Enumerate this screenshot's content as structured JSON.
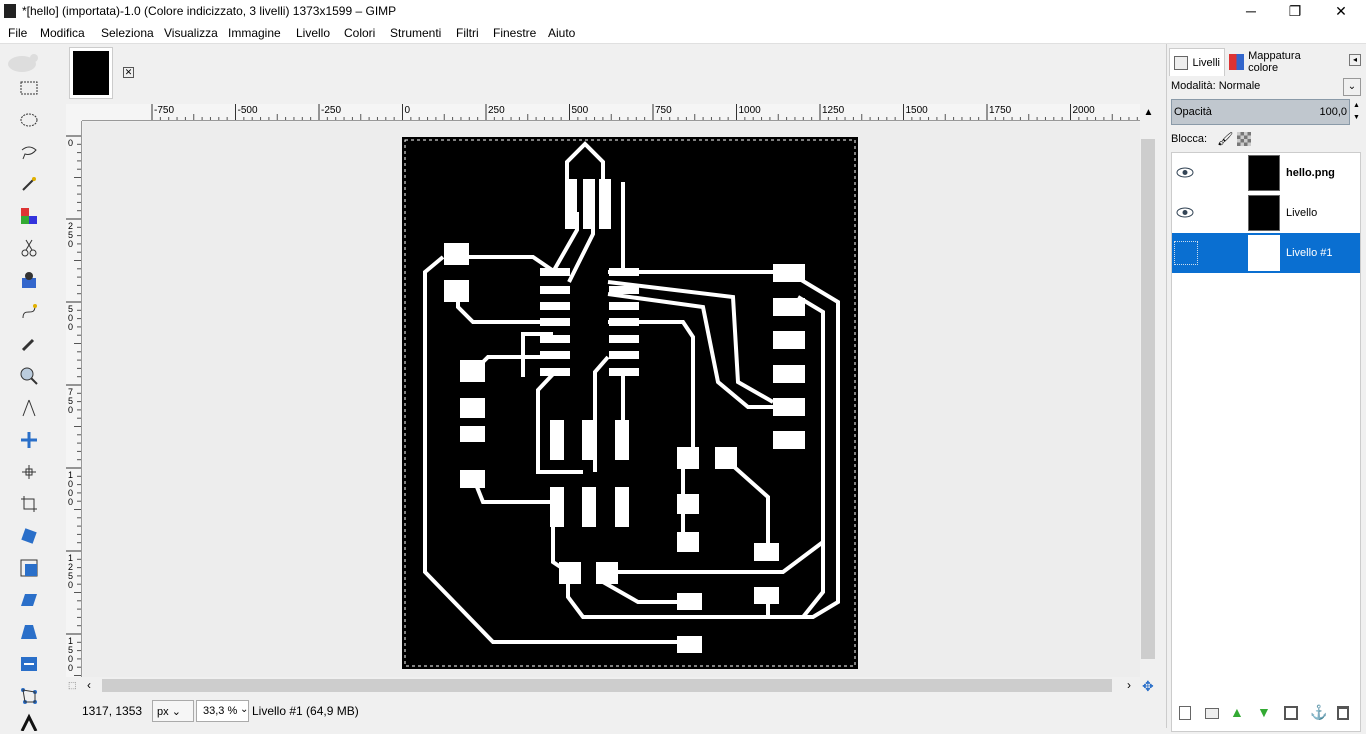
{
  "window": {
    "title": "*[hello] (importata)-1.0 (Colore indicizzato, 3 livelli) 1373x1599 – GIMP"
  },
  "menu": [
    "File",
    "Modifica",
    "Seleziona",
    "Visualizza",
    "Immagine",
    "Livello",
    "Colori",
    "Strumenti",
    "Filtri",
    "Finestre",
    "Aiuto"
  ],
  "tools": [
    "rect-select-icon",
    "ellipse-select-icon",
    "free-select-icon",
    "fuzzy-select-icon",
    "color-select-icon",
    "scissors-select-icon",
    "foreground-select-icon",
    "paths-icon",
    "color-picker-icon",
    "zoom-icon",
    "measure-icon",
    "move-icon",
    "alignment-icon",
    "crop-icon",
    "rotate-icon",
    "scale-icon",
    "shear-icon",
    "perspective-icon",
    "flip-icon",
    "cage-icon",
    "text-icon"
  ],
  "ruler_h": [
    "-750",
    "-500",
    "-250",
    "0",
    "250",
    "500",
    "750",
    "1000",
    "1250",
    "1500",
    "1750",
    "2000"
  ],
  "ruler_v": [
    "0",
    "2\n5\n0",
    "5\n0\n0",
    "7\n5\n0",
    "1\n0\n0\n0",
    "1\n2\n5\n0",
    "1\n5\n0\n0"
  ],
  "status": {
    "coords": "1317, 1353",
    "unit": "px",
    "zoom": "33,3 %",
    "layer_info": "Livello #1 (64,9 MB)"
  },
  "dock": {
    "tab_layers": "Livelli",
    "tab_colormap": "Mappatura colore",
    "mode_label": "Modalità:",
    "mode_value": "Normale",
    "opacity_label": "Opacità",
    "opacity_value": "100,0",
    "lock_label": "Blocca:",
    "layers": [
      {
        "name": "hello.png",
        "visible": true,
        "selected": false
      },
      {
        "name": "Livello",
        "visible": true,
        "selected": false
      },
      {
        "name": "Livello #1",
        "visible": false,
        "selected": true
      }
    ]
  },
  "colors": {
    "accent": "#0a6fd1",
    "canvas": "#000000",
    "trace": "#ffffff"
  }
}
